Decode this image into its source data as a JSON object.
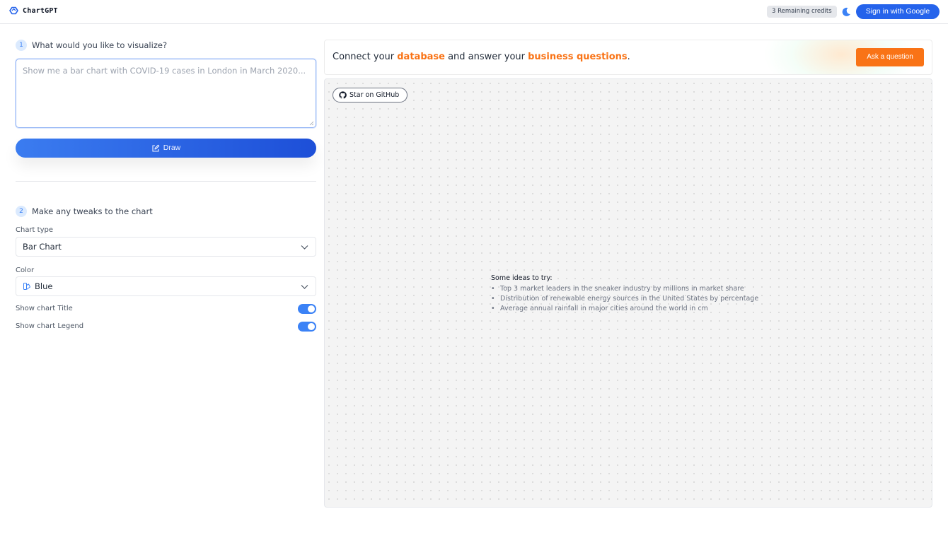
{
  "header": {
    "app_name": "ChartGPT",
    "credits": "3 Remaining credits",
    "signin_label": "Sign in with Google"
  },
  "step1": {
    "number": "1",
    "label": "What would you like to visualize?",
    "placeholder": "Show me a bar chart with COVID-19 cases in London in March 2020...",
    "draw_label": "Draw"
  },
  "step2": {
    "number": "2",
    "label": "Make any tweaks to the chart",
    "chart_type_label": "Chart type",
    "chart_type_value": "Bar Chart",
    "color_label": "Color",
    "color_value": "Blue",
    "show_title_label": "Show chart Title",
    "show_title_on": true,
    "show_legend_label": "Show chart Legend",
    "show_legend_on": true
  },
  "banner": {
    "text_1": "Connect your ",
    "highlight_1": "database",
    "text_2": " and answer your ",
    "highlight_2": "business questions",
    "text_3": ".",
    "ask_label": "Ask a question"
  },
  "canvas": {
    "github_label": "Star on GitHub",
    "ideas_title": "Some ideas to try:",
    "ideas": [
      "Top 3 market leaders in the sneaker industry by millions in market share",
      "Distribution of renewable energy sources in the United States by percentage",
      "Average annual rainfall in major cities around the world in cm"
    ]
  },
  "colors": {
    "primary": "#2563eb",
    "accent": "#f97316"
  }
}
